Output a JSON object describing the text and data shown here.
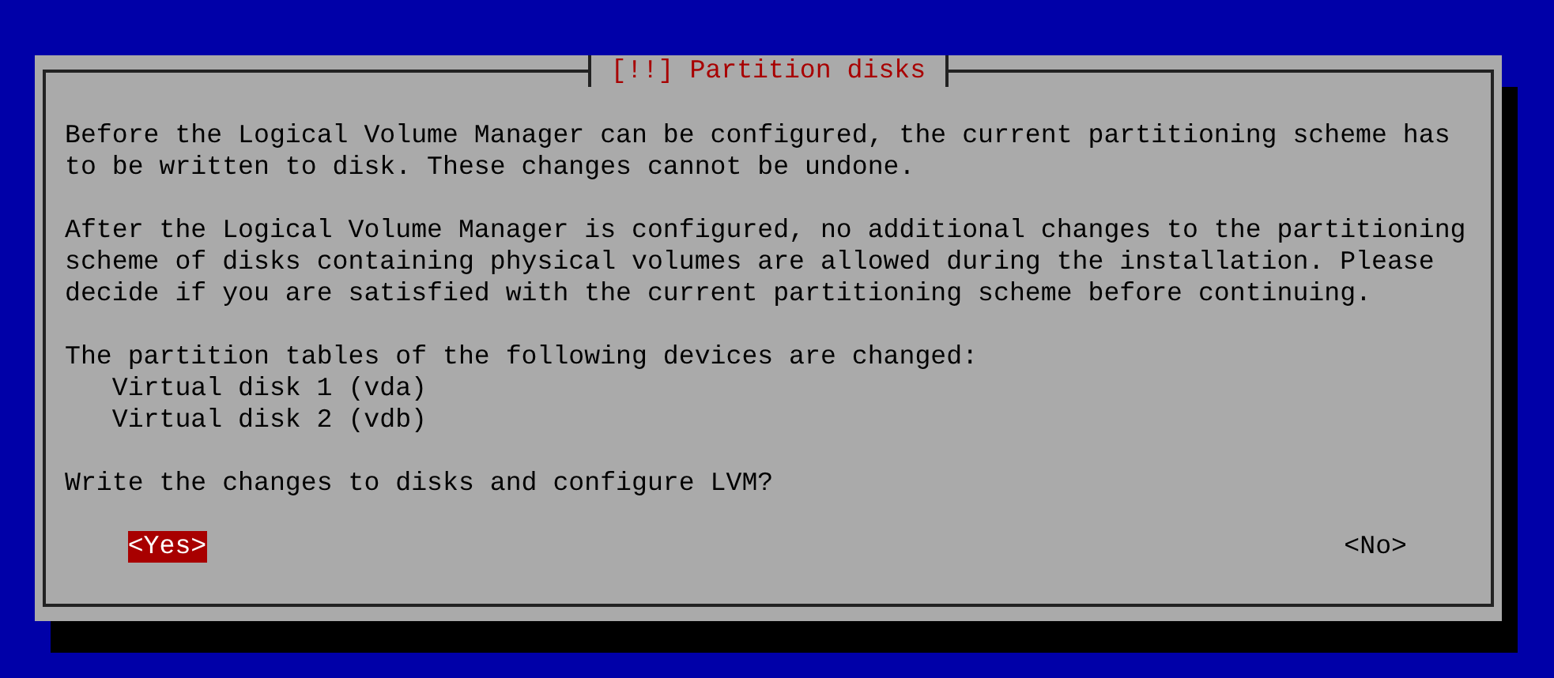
{
  "dialog": {
    "title": "[!!] Partition disks",
    "paragraphs": [
      "Before the Logical Volume Manager can be configured, the current partitioning scheme has to be written to disk. These changes cannot be undone.",
      "After the Logical Volume Manager is configured, no additional changes to the partitioning scheme of disks containing physical volumes are allowed during the installation. Please decide if you are satisfied with the current partitioning scheme before continuing."
    ],
    "devices_heading": "The partition tables of the following devices are changed:",
    "devices": [
      "Virtual disk 1 (vda)",
      "Virtual disk 2 (vdb)"
    ],
    "question": "Write the changes to disks and configure LVM?",
    "buttons": [
      {
        "label": "<Yes>",
        "selected": true
      },
      {
        "label": "<No>",
        "selected": false
      }
    ]
  }
}
